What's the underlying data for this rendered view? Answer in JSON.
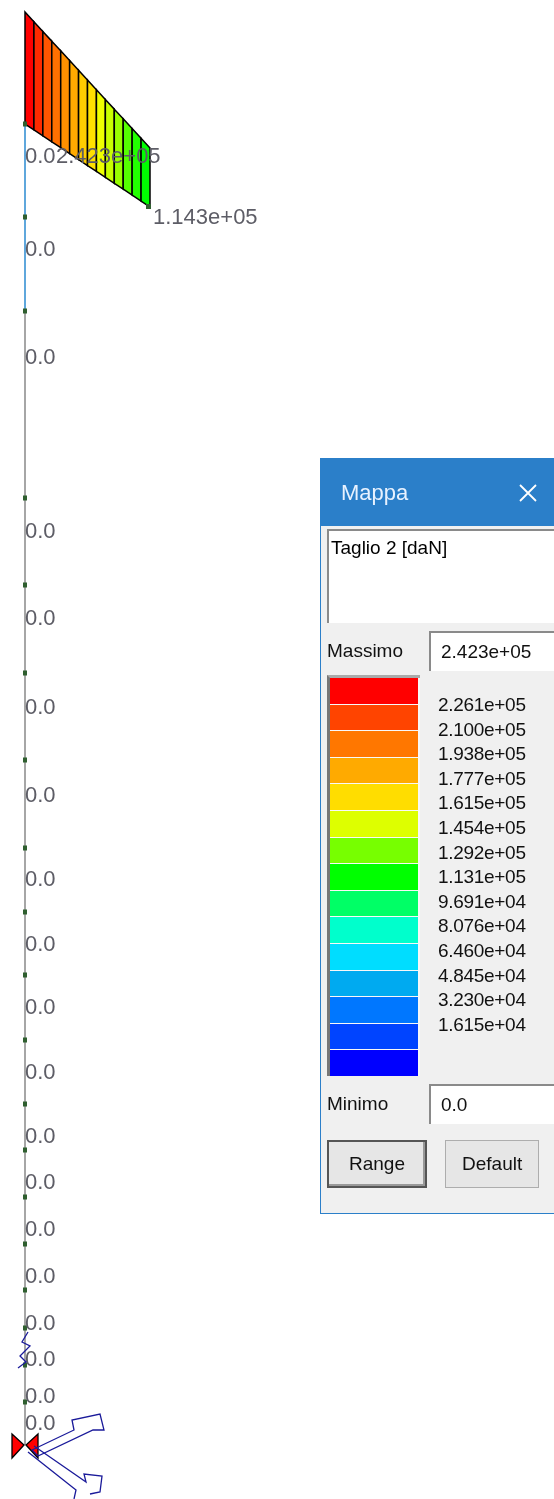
{
  "diagram": {
    "peak_labels": [
      "2.423e+05",
      "1.143e+05"
    ],
    "member_labels": [
      "0.0",
      "0.0",
      "0.0",
      "0.0",
      "0.0",
      "0.0",
      "0.0",
      "0.0",
      "0.0",
      "0.0",
      "0.0",
      "0.0",
      "0.0",
      "0.0",
      "0.0",
      "0.0",
      "0.0",
      "0.0",
      "0.0"
    ]
  },
  "dialog": {
    "title": "Mappa",
    "quantity": "Taglio 2 [daN]",
    "max_label": "Massimo",
    "max_value": "2.423e+05",
    "scale": [
      {
        "color": "#ff0000"
      },
      {
        "color": "#ff4400"
      },
      {
        "color": "#ff7700"
      },
      {
        "color": "#ffaa00"
      },
      {
        "color": "#ffdd00"
      },
      {
        "color": "#ddff00"
      },
      {
        "color": "#77ff00"
      },
      {
        "color": "#00ff00"
      },
      {
        "color": "#00ff66"
      },
      {
        "color": "#00ffcc"
      },
      {
        "color": "#00ddff"
      },
      {
        "color": "#00aaf0"
      },
      {
        "color": "#0077ff"
      },
      {
        "color": "#0044ff"
      },
      {
        "color": "#0000ff"
      }
    ],
    "scale_values": [
      "2.261e+05",
      "2.100e+05",
      "1.938e+05",
      "1.777e+05",
      "1.615e+05",
      "1.454e+05",
      "1.292e+05",
      "1.131e+05",
      "9.691e+04",
      "8.076e+04",
      "6.460e+04",
      "4.845e+04",
      "3.230e+04",
      "1.615e+04"
    ],
    "min_label": "Minimo",
    "min_value": "0.0",
    "buttons": [
      "Range",
      "Default"
    ]
  }
}
